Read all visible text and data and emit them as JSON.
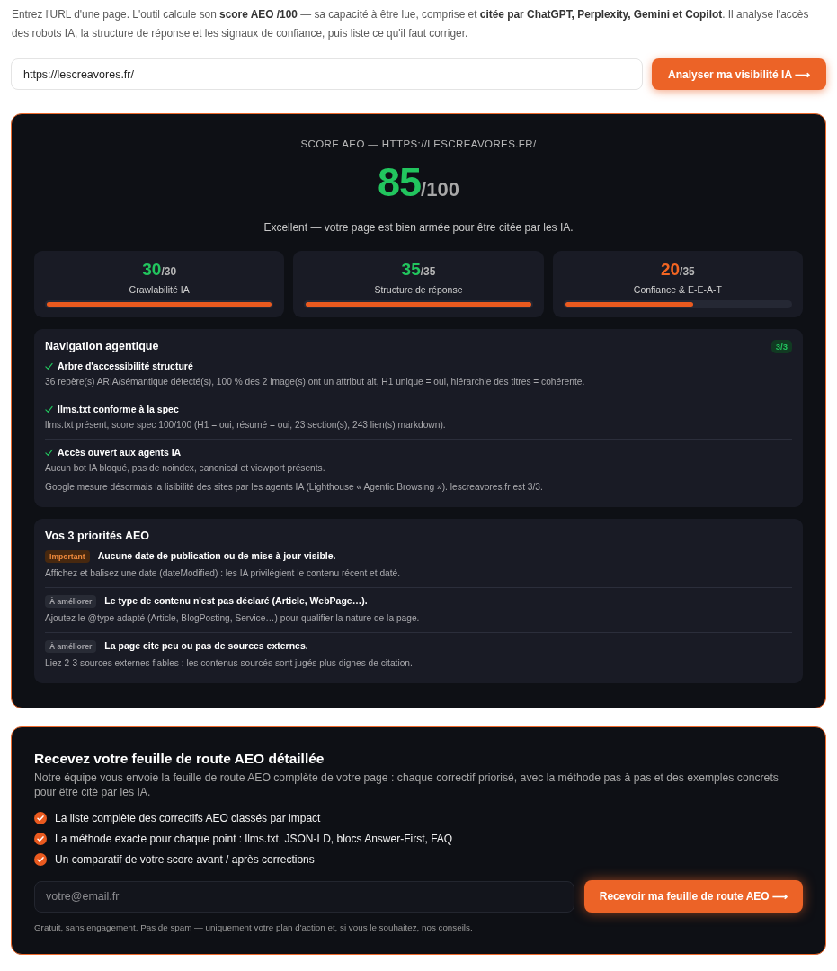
{
  "intro": {
    "text": "Entrez l'URL d'une page. L'outil calcule son **score AEO /100** — sa capacité à être lue, comprise et **citée par ChatGPT, Perplexity, Gemini et Copilot**. Il analyse l'accès des robots IA, la structure de réponse et les signaux de confiance, puis liste ce qu'il faut corriger."
  },
  "url_form": {
    "value": "https://lescreavores.fr/",
    "button": "Analyser ma visibilité IA ⟶"
  },
  "score": {
    "title": "SCORE AEO — HTTPS://LESCREAVORES.FR/",
    "value": "85",
    "max": "/100",
    "verdict": "Excellent — votre page est bien armée pour être citée par les IA."
  },
  "subscores": [
    {
      "value": "30",
      "max": "/30",
      "label": "Crawlabilité IA",
      "level": 1,
      "color": "#22c55e"
    },
    {
      "value": "35",
      "max": "/35",
      "label": "Structure de réponse",
      "level": 1,
      "color": "#22c55e"
    },
    {
      "value": "20",
      "max": "/35",
      "label": "Confiance & E-E-A-T",
      "level": 0.57,
      "color": "#f26522"
    }
  ],
  "navigation": {
    "title": "Navigation agentique",
    "badge": "3/3",
    "items": [
      {
        "passed": true,
        "title": "Arbre d'accessibilité structuré",
        "details": [
          "36 repère(s) ARIA/sémantique détecté(s), 100 % des 2 image(s) ont un attribut alt, H1 unique = oui, hiérarchie des titres = cohérente."
        ]
      },
      {
        "passed": true,
        "title": "llms.txt conforme à la spec",
        "details": [
          "llms.txt présent, score spec 100/100 (H1 = oui, résumé = oui, 23 section(s), 243 lien(s) markdown)."
        ]
      },
      {
        "passed": true,
        "title": "Accès ouvert aux agents IA",
        "details": [
          "Aucun bot IA bloqué, pas de noindex, canonical et viewport présents.",
          "Google mesure désormais la lisibilité des sites par les agents IA (Lighthouse « Agentic Browsing »). lescreavores.fr est 3/3."
        ]
      }
    ]
  },
  "priorities": {
    "title": "Vos 3 priorités AEO",
    "items": [
      {
        "kind": "important",
        "badge": "Important",
        "title": "Aucune date de publication ou de mise à jour visible.",
        "text": "Affichez et balisez une date (dateModified) : les IA privilégient le contenu récent et daté."
      },
      {
        "kind": "improve",
        "badge": "À améliorer",
        "title": "Le type de contenu n'est pas déclaré (Article, WebPage…).",
        "text": "Ajoutez le @type adapté (Article, BlogPosting, Service…) pour qualifier la nature de la page."
      },
      {
        "kind": "improve",
        "badge": "À améliorer",
        "title": "La page cite peu ou pas de sources externes.",
        "text": "Liez 2-3 sources externes fiables : les contenus sourcés sont jugés plus dignes de citation."
      }
    ]
  },
  "lead": {
    "title": "Recevez votre feuille de route AEO détaillée",
    "text": "Notre équipe vous envoie la feuille de route AEO complète de votre page : chaque correctif priorisé, avec la méthode pas à pas et des exemples concrets pour être cité par les IA.",
    "benefits": [
      "La liste complète des correctifs AEO classés par impact",
      "La méthode exacte pour chaque point : llms.txt, JSON-LD, blocs Answer-First, FAQ",
      "Un comparatif de votre score avant / après corrections"
    ],
    "placeholder": "votre@email.fr",
    "button": "Recevoir ma feuille de route AEO ⟶",
    "note": "Gratuit, sans engagement. Pas de spam — uniquement votre plan d'action et, si vous le souhaitez, nos conseils."
  }
}
